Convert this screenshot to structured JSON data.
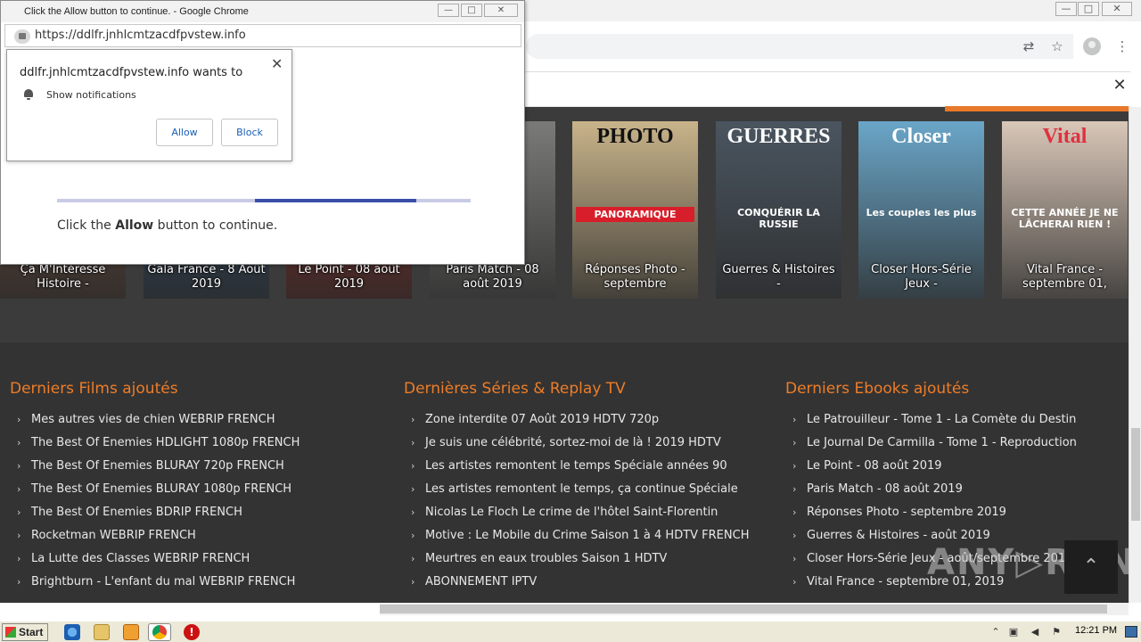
{
  "popup": {
    "window_title": "Click the Allow button to continue. - Google Chrome",
    "url": "https://ddlfr.jnhlcmtzacdfpvstew.info",
    "permission": {
      "title": "ddlfr.jnhlcmtzacdfpvstew.info wants to",
      "item": "Show notifications",
      "allow_label": "Allow",
      "block_label": "Block",
      "close_glyph": "✕"
    },
    "progress": 0.39,
    "message_prefix": "Click the ",
    "message_bold": "Allow",
    "message_suffix": " button to continue."
  },
  "main_window": {
    "controls": [
      "—",
      "□",
      "✕"
    ],
    "icons": [
      "translate-icon",
      "star-icon",
      "account-icon",
      "menu-icon"
    ],
    "infobar_close": "✕"
  },
  "covers": [
    {
      "label": "Ça M'Intéresse Histoire -",
      "color": "#6a4a3a",
      "masthead": ""
    },
    {
      "label": "Gala France - 8 Août 2019",
      "color": "#2f4a66",
      "masthead": ""
    },
    {
      "label": "Le Point - 08 août 2019",
      "color": "#8a2a22",
      "masthead": ""
    },
    {
      "label": "Paris Match - 08 août 2019",
      "color": "#7a7a78",
      "masthead": ""
    },
    {
      "label": "Réponses Photo - septembre",
      "color": "#c9b48a",
      "masthead": "PHOTO",
      "sub": "PANORAMIQUE"
    },
    {
      "label": "Guerres & Histoires -",
      "color": "#4a5560",
      "masthead": "GUERRES",
      "sub": "CONQUÉRIR LA RUSSIE"
    },
    {
      "label": "Closer Hors-Série Jeux -",
      "color": "#6aa6c8",
      "masthead": "Closer",
      "sub": "Les couples les plus"
    },
    {
      "label": "Vital France - septembre 01,",
      "color": "#d9c7b8",
      "masthead": "Vital",
      "sub": "CETTE ANNÉE JE NE LÂCHERAI RIEN !"
    }
  ],
  "columns": [
    {
      "title": "Derniers Films ajoutés",
      "items": [
        "Mes autres vies de chien WEBRIP FRENCH",
        "The Best Of Enemies HDLIGHT 1080p FRENCH",
        "The Best Of Enemies BLURAY 720p FRENCH",
        "The Best Of Enemies BLURAY 1080p FRENCH",
        "The Best Of Enemies BDRIP FRENCH",
        "Rocketman WEBRIP FRENCH",
        "La Lutte des Classes WEBRIP FRENCH",
        "Brightburn - L'enfant du mal WEBRIP FRENCH"
      ]
    },
    {
      "title": "Dernières Séries & Replay TV",
      "items": [
        "Zone interdite 07 Août 2019 HDTV 720p",
        "Je suis une célébrité, sortez-moi de là ! 2019 HDTV",
        "Les artistes remontent le temps Spéciale années 90",
        "Les artistes remontent le temps, ça continue Spéciale",
        "Nicolas Le Floch Le crime de l'hôtel Saint-Florentin",
        "Motive : Le Mobile du Crime Saison 1 à 4 HDTV FRENCH",
        "Meurtres en eaux troubles Saison 1 HDTV",
        "ABONNEMENT IPTV"
      ]
    },
    {
      "title": "Derniers Ebooks ajoutés",
      "items": [
        "Le Patrouilleur - Tome 1 - La Comète du Destin",
        "Le Journal De Carmilla - Tome 1 - Reproduction",
        "Le Point - 08 août 2019",
        "Paris Match - 08 août 2019",
        "Réponses Photo - septembre 2019",
        "Guerres & Histoires - août 2019",
        "Closer Hors-Série Jeux - août/septembre 2019",
        "Vital France - septembre 01, 2019"
      ]
    }
  ],
  "back_to_top_glyph": "⌃",
  "watermark": "ANY▷RUN",
  "taskbar": {
    "start_label": "Start",
    "apps": [
      "ie-icon",
      "folder-icon",
      "media-player-icon",
      "chrome-icon",
      "warning-icon"
    ],
    "time": "12:21 PM"
  }
}
